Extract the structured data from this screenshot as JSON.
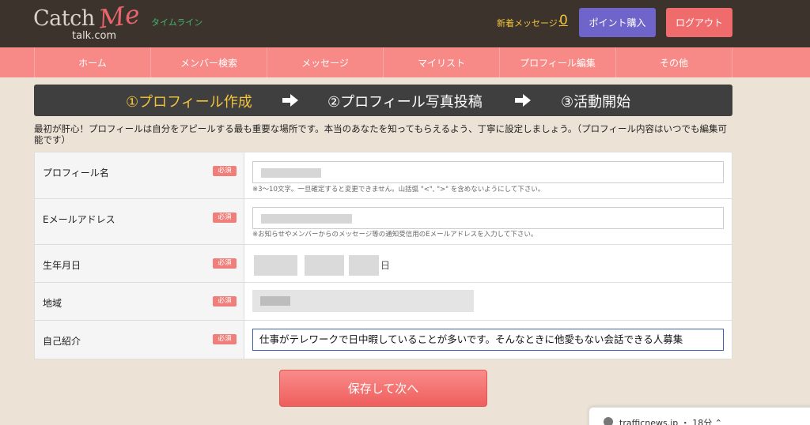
{
  "header": {
    "logo_catch": "Catch",
    "logo_me": "Me",
    "logo_talk": "talk.com",
    "timeline": "タイムライン",
    "new_message_label": "新着メッセージ：",
    "new_message_count": "0",
    "points_button": "ポイント購入",
    "logout_button": "ログアウト"
  },
  "nav": {
    "items": [
      {
        "label": "ホーム"
      },
      {
        "label": "メンバー検索"
      },
      {
        "label": "メッセージ"
      },
      {
        "label": "マイリスト"
      },
      {
        "label": "プロフィール編集"
      },
      {
        "label": "その他"
      }
    ]
  },
  "steps": {
    "step1": "①プロフィール作成",
    "step2": "②プロフィール写真投稿",
    "step3": "③活動開始"
  },
  "intro_text": "最初が肝心！プロフィールは自分をアピールする最も重要な場所です。本当のあなたを知ってもらえるよう、丁寧に設定しましょう。（プロフィール内容はいつでも編集可能です）",
  "form": {
    "required_badge": "必須",
    "profile_name": {
      "label": "プロフィール名",
      "hint": "※3〜10文字。一旦確定すると変更できません。山括弧 \"<\", \">\" を含めないようにして下さい。"
    },
    "email": {
      "label": "Eメールアドレス",
      "hint": "※お知らせやメンバーからのメッセージ等の通知受信用のEメールアドレスを入力して下さい。"
    },
    "birthdate": {
      "label": "生年月日",
      "day_suffix": "日"
    },
    "region": {
      "label": "地域"
    },
    "self_intro": {
      "label": "自己紹介",
      "value": "仕事がテレワークで日中暇していることが多いです。そんなときに他愛もない会話できる人募集"
    }
  },
  "save_button": "保存して次へ",
  "notification": {
    "text": "trafficnews.jp ・ 18分 ⌃"
  },
  "colors": {
    "header_bg": "#3b332c",
    "nav_bg": "#f78a87",
    "accent_yellow": "#f2c33b",
    "points_purple": "#6f64c9",
    "logout_red": "#f06c6c"
  }
}
